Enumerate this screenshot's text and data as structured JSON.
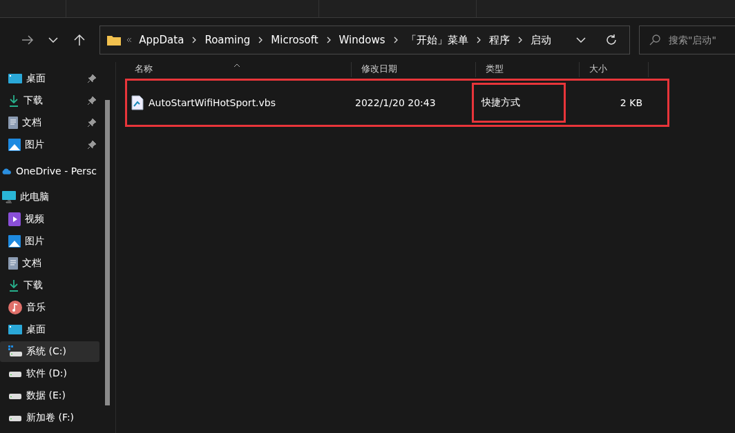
{
  "nav": {
    "breadcrumb": [
      "AppData",
      "Roaming",
      "Microsoft",
      "Windows",
      "「开始」菜单",
      "程序",
      "启动"
    ],
    "search": {
      "placeholder": "搜索\"启动\""
    }
  },
  "sidebar": {
    "quick_access": [
      {
        "label": "桌面",
        "kind": "desktop",
        "pinned": true,
        "selected": false
      },
      {
        "label": "下载",
        "kind": "download",
        "pinned": true,
        "selected": false
      },
      {
        "label": "文档",
        "kind": "document",
        "pinned": true,
        "selected": false
      },
      {
        "label": "图片",
        "kind": "picture",
        "pinned": true,
        "selected": false
      }
    ],
    "onedrive": {
      "label": "OneDrive - Persc",
      "kind": "cloud",
      "selected": false
    },
    "this_pc": {
      "label": "此电脑",
      "kind": "monitor",
      "selected": false,
      "children": [
        {
          "label": "视频",
          "kind": "video",
          "selected": false
        },
        {
          "label": "图片",
          "kind": "picture",
          "selected": false
        },
        {
          "label": "文档",
          "kind": "document",
          "selected": false
        },
        {
          "label": "下载",
          "kind": "download",
          "selected": false
        },
        {
          "label": "音乐",
          "kind": "music",
          "selected": false
        },
        {
          "label": "桌面",
          "kind": "desktop",
          "selected": false
        },
        {
          "label": "系统 (C:)",
          "kind": "system-drive",
          "selected": true
        },
        {
          "label": "软件 (D:)",
          "kind": "drive",
          "selected": false
        },
        {
          "label": "数据 (E:)",
          "kind": "drive",
          "selected": false
        },
        {
          "label": "新加卷 (F:)",
          "kind": "drive",
          "selected": false
        }
      ]
    }
  },
  "table": {
    "columns": [
      "名称",
      "修改日期",
      "类型",
      "大小"
    ],
    "rows": [
      {
        "name": "AutoStartWifiHotSport.vbs",
        "modified": "2022/1/20 20:43",
        "type": "快捷方式",
        "size": "2 KB",
        "highlighted": true,
        "type_highlighted": true
      }
    ]
  }
}
